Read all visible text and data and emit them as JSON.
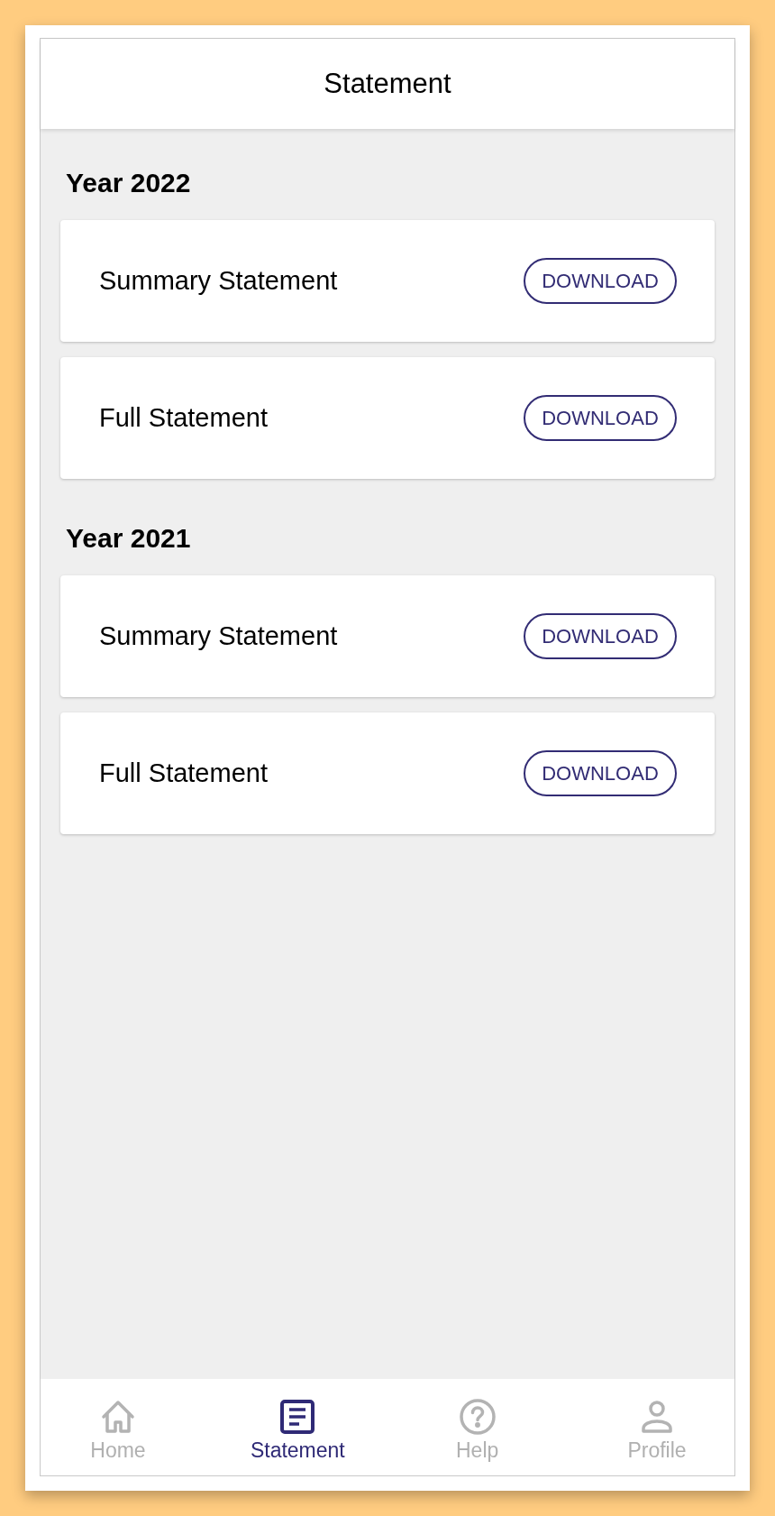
{
  "header": {
    "title": "Statement"
  },
  "sections": [
    {
      "heading": "Year 2022",
      "items": [
        {
          "label": "Summary Statement",
          "button": "DOWNLOAD"
        },
        {
          "label": "Full Statement",
          "button": "DOWNLOAD"
        }
      ]
    },
    {
      "heading": "Year 2021",
      "items": [
        {
          "label": "Summary Statement",
          "button": "DOWNLOAD"
        },
        {
          "label": "Full Statement",
          "button": "DOWNLOAD"
        }
      ]
    }
  ],
  "bottom_nav": [
    {
      "label": "Home",
      "kind": "home",
      "selected": false
    },
    {
      "label": "Statement",
      "kind": "statement",
      "selected": true
    },
    {
      "label": "Help",
      "kind": "help",
      "selected": false
    },
    {
      "label": "Profile",
      "kind": "profile",
      "selected": false
    }
  ]
}
